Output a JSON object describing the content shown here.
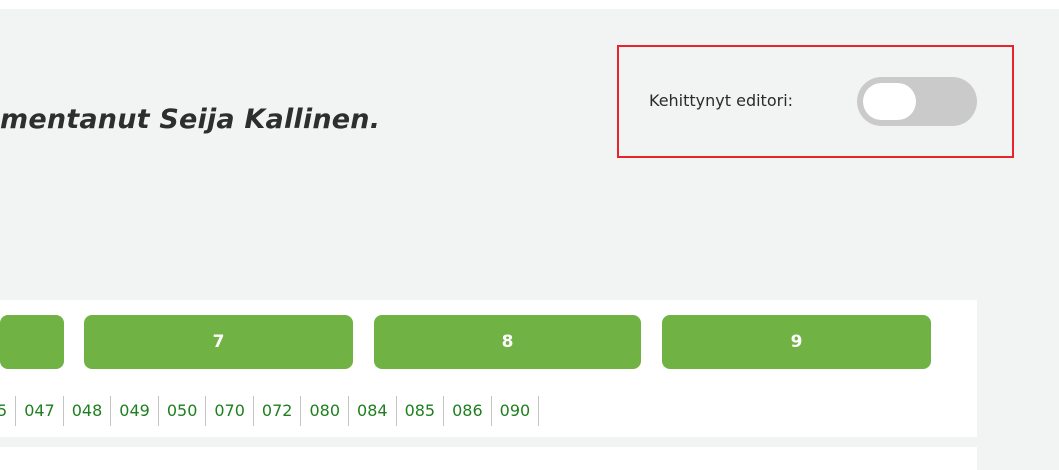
{
  "heading": "mentanut Seija Kallinen.",
  "editor": {
    "label": "Kehittynyt editori:",
    "enabled": false
  },
  "chapters": [
    "",
    "7",
    "8",
    "9"
  ],
  "verses": [
    "5",
    "047",
    "048",
    "049",
    "050",
    "070",
    "072",
    "080",
    "084",
    "085",
    "086",
    "090"
  ],
  "colors": {
    "button": "#71b244",
    "link": "#1e7f1e",
    "highlight": "#e8232b",
    "background": "#f2f3f3"
  }
}
